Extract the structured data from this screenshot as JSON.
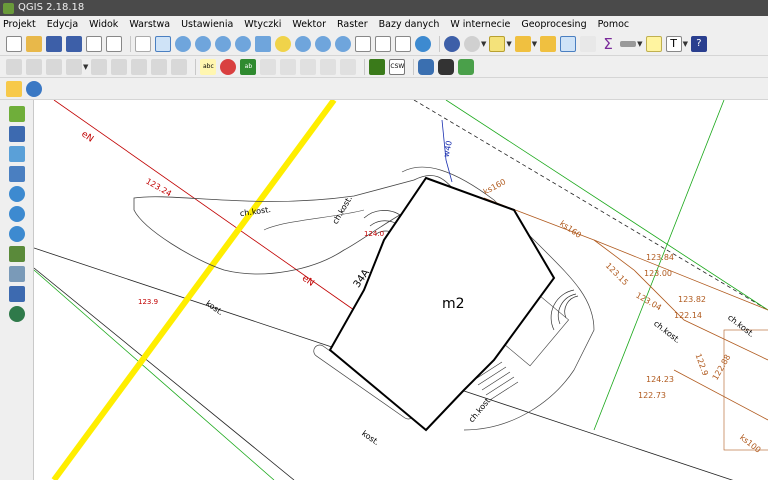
{
  "window": {
    "title": "QGIS 2.18.18"
  },
  "menu": [
    "Projekt",
    "Edycja",
    "Widok",
    "Warstwa",
    "Ustawienia",
    "Wtyczki",
    "Wektor",
    "Raster",
    "Bazy danych",
    "W internecie",
    "Geoprocesing",
    "Pomoc"
  ],
  "toolbar": {
    "csw_label": "CSW",
    "abc_label": "abc",
    "ab_label": "ab",
    "text_tool_label": "T"
  },
  "map_labels": {
    "building": "m2",
    "floors": "34A",
    "en_top": "eN",
    "en_mid": "eN",
    "w40": "w40",
    "ks160_a": "ks160",
    "ks160_b": "ks160",
    "ks100": "ks100",
    "h123_24": "123.24",
    "h124_0": "124.0",
    "h123_9": "123.9",
    "h123_84": "123.84",
    "h123_00": "123.00",
    "h123_15": "123.15",
    "h123_04": "123.04",
    "h123_82": "123.82",
    "h122_14": "122.14",
    "h122_9": "122.9",
    "h122_88": "122.88",
    "h124_23": "124.23",
    "h122_73": "122.73",
    "chkost_1": "ch.kost.",
    "chkost_2": "ch.kost.",
    "chkost_3": "ch.kost.",
    "chkost_4": "ch.kost.",
    "chkost_5": "ch.kost.",
    "kost_1": "kost.",
    "kost_2": "kost."
  },
  "colors": {
    "road_line": "#ffee00",
    "utility_red": "#c00000",
    "utility_brown": "#b05a1e",
    "utility_blue": "#1a2fb0",
    "boundary_green": "#1aa81a",
    "outline": "#000000",
    "canvas_bg": "#ffffff"
  }
}
